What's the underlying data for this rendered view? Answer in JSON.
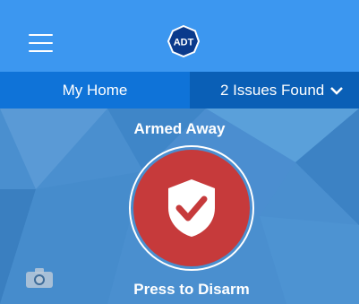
{
  "header": {
    "menu_icon": "hamburger-menu-icon",
    "logo_text": "ADT",
    "brand_color": "#3c97f0"
  },
  "subbar": {
    "location_label": "My Home",
    "issues_label": "2 Issues Found",
    "issues_icon": "chevron-down-icon"
  },
  "security": {
    "status_label": "Armed Away",
    "action_label": "Press to Disarm",
    "button_color": "#c63a3b",
    "icon": "shield-check-icon"
  },
  "footer": {
    "camera_icon": "camera-icon"
  }
}
